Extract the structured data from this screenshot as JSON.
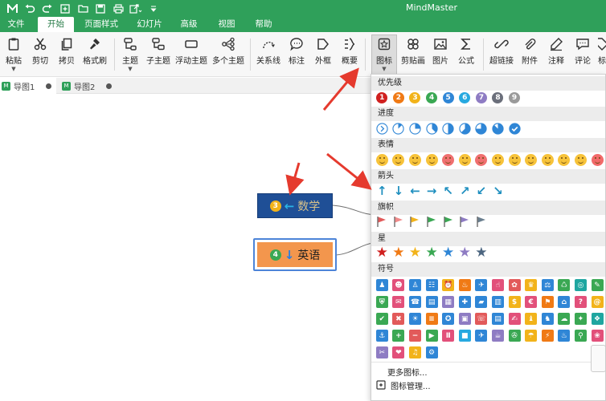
{
  "app": {
    "title": "MindMaster"
  },
  "menu": [
    "文件",
    "开始",
    "页面样式",
    "幻灯片",
    "高级",
    "视图",
    "帮助"
  ],
  "active_menu": "开始",
  "ribbon": [
    {
      "label": "粘贴",
      "icon": "clipboard-icon",
      "caret": true
    },
    {
      "label": "剪切",
      "icon": "scissors-icon"
    },
    {
      "label": "拷贝",
      "icon": "copy-icon"
    },
    {
      "label": "格式刷",
      "icon": "format-brush-icon"
    },
    {
      "label": "主题",
      "icon": "topic-icon",
      "caret": true
    },
    {
      "label": "子主题",
      "icon": "subtopic-icon"
    },
    {
      "label": "浮动主题",
      "icon": "floating-topic-icon"
    },
    {
      "label": "多个主题",
      "icon": "multiple-topics-icon"
    },
    {
      "label": "关系线",
      "icon": "relationship-icon"
    },
    {
      "label": "标注",
      "icon": "callout-icon"
    },
    {
      "label": "外框",
      "icon": "boundary-icon"
    },
    {
      "label": "概要",
      "icon": "summary-icon"
    },
    {
      "label": "图标",
      "icon": "icon-gallery-icon",
      "caret": true,
      "selected": true
    },
    {
      "label": "剪贴画",
      "icon": "clipart-icon"
    },
    {
      "label": "图片",
      "icon": "picture-icon"
    },
    {
      "label": "公式",
      "icon": "formula-icon"
    },
    {
      "label": "超链接",
      "icon": "hyperlink-icon"
    },
    {
      "label": "附件",
      "icon": "attachment-icon"
    },
    {
      "label": "注释",
      "icon": "note-icon"
    },
    {
      "label": "评论",
      "icon": "comment-icon"
    },
    {
      "label": "标",
      "icon": "tag-icon"
    }
  ],
  "tabs": [
    {
      "label": "导图1",
      "modified": true
    },
    {
      "label": "导图2",
      "modified": true
    }
  ],
  "canvas": {
    "topic_math": {
      "badge": "3",
      "text": "数学"
    },
    "topic_english": {
      "badge": "4",
      "text": "英语"
    }
  },
  "icon_panel": {
    "sections": [
      {
        "title": "优先级",
        "kind": "priority",
        "items": [
          "1",
          "2",
          "3",
          "4",
          "5",
          "6",
          "7",
          "8",
          "9"
        ],
        "colors": [
          "#d0201f",
          "#f07a15",
          "#f2b31a",
          "#3aa853",
          "#2f86d6",
          "#27a9e0",
          "#8e7cc3",
          "#6b6f7b",
          "#9a9a9a"
        ]
      },
      {
        "title": "进度",
        "kind": "progress",
        "items": [
          "0",
          "1/8",
          "2/8",
          "3/8",
          "4/8",
          "5/8",
          "6/8",
          "7/8",
          "done"
        ]
      },
      {
        "title": "表情",
        "kind": "emoji",
        "count": 14
      },
      {
        "title": "箭头",
        "kind": "arrow",
        "items": [
          "↑",
          "↓",
          "←",
          "→",
          "↖",
          "↗",
          "↙",
          "↘"
        ],
        "color": "#1f8fbf"
      },
      {
        "title": "旗帜",
        "kind": "flag",
        "colors": [
          "#e25a5a",
          "#f08a8a",
          "#f2b31a",
          "#3aa853",
          "#3aa853",
          "#8e7cc3",
          "#6b7f8f"
        ]
      },
      {
        "title": "星",
        "kind": "star",
        "colors": [
          "#d0201f",
          "#f07a15",
          "#f2b31a",
          "#3aa853",
          "#2f86d6",
          "#8e7cc3",
          "#4d6680"
        ]
      },
      {
        "title": "符号",
        "kind": "symbol",
        "rows": [
          [
            "#2f86d6",
            "#e2507a",
            "#2f86d6",
            "#2f86d6",
            "#f2b31a",
            "#f07a15",
            "#2f86d6",
            "#e2507a",
            "#e25a5a",
            "#f2b31a",
            "#2f86d6",
            "#3aa853",
            "#1fa6a0",
            "#3aa853"
          ],
          [
            "#3aa853",
            "#e2507a",
            "#2f86d6",
            "#2f86d6",
            "#8e7cc3",
            "#2f86d6",
            "#2f86d6",
            "#2f86d6",
            "#f2b31a",
            "#e2507a",
            "#f07a15",
            "#2f86d6",
            "#e2507a",
            "#f2b31a"
          ],
          [
            "#3aa853",
            "#e25a5a",
            "#2f86d6",
            "#f07a15",
            "#2f86d6",
            "#8e7cc3",
            "#e25a5a",
            "#2f86d6",
            "#e2507a",
            "#f2b31a",
            "#2f86d6",
            "#3aa853",
            "#3aa853",
            "#1fa6a0"
          ],
          [
            "#2f86d6",
            "#3aa853",
            "#e25a5a",
            "#3aa853",
            "#e2507a",
            "#27a9e0",
            "#2f86d6",
            "#8e7cc3",
            "#3aa853",
            "#f2b31a",
            "#f07a15",
            "#2f86d6",
            "#3aa853",
            "#e2507a"
          ],
          [
            "#8e7cc3",
            "#e2507a",
            "#f2b31a",
            "#2f86d6"
          ]
        ]
      }
    ],
    "footer": [
      {
        "label": "更多图标...",
        "icon": ""
      },
      {
        "label": "图标管理...",
        "icon": "icon-manage-icon"
      }
    ]
  },
  "colors": {
    "brand": "#2fa05a",
    "annotation_arrow": "#e53a2e",
    "topic_math_fill": "#1f4f96",
    "topic_english_fill": "#f3964d"
  }
}
